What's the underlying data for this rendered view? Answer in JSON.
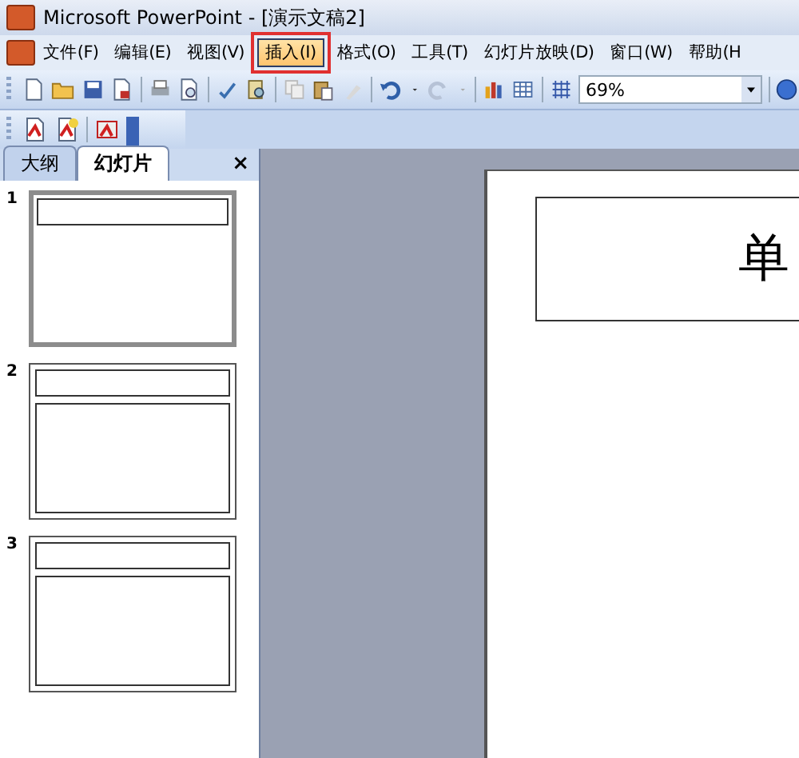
{
  "window": {
    "title": "Microsoft PowerPoint - [演示文稿2]"
  },
  "menu": [
    {
      "label": "文件(F)",
      "selected": false
    },
    {
      "label": "编辑(E)",
      "selected": false
    },
    {
      "label": "视图(V)",
      "selected": false
    },
    {
      "label": "插入(I)",
      "selected": true
    },
    {
      "label": "格式(O)",
      "selected": false
    },
    {
      "label": "工具(T)",
      "selected": false
    },
    {
      "label": "幻灯片放映(D)",
      "selected": false
    },
    {
      "label": "窗口(W)",
      "selected": false
    },
    {
      "label": "帮助(H",
      "selected": false
    }
  ],
  "toolbar": {
    "zoom": "69%"
  },
  "pane": {
    "tabs": [
      {
        "label": "大纲",
        "selected": false
      },
      {
        "label": "幻灯片",
        "selected": true
      }
    ],
    "close": "×"
  },
  "slides": [
    {
      "number": "1",
      "kind": "title",
      "selected": true
    },
    {
      "number": "2",
      "kind": "title-content",
      "selected": false
    },
    {
      "number": "3",
      "kind": "title-content",
      "selected": false
    }
  ],
  "slide": {
    "title_placeholder": "单"
  }
}
